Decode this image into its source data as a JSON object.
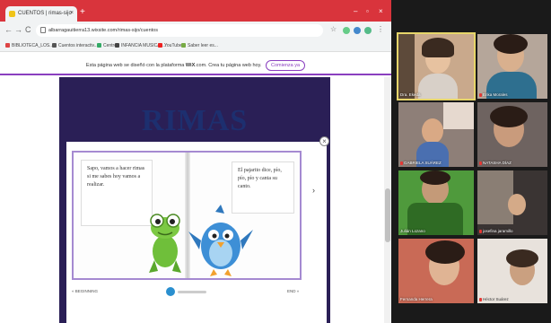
{
  "browser": {
    "tab_title": "CUENTOS | rimas-sijo",
    "tab_close": "×",
    "new_tab": "+",
    "window_controls": [
      "–",
      "▫",
      "×"
    ],
    "nav": {
      "back": "←",
      "forward": "→",
      "reload": "C"
    },
    "url": "albarragauitierra13.wixsite.com/rimas-sijo/cuentos",
    "bookmarks": [
      {
        "label": "BIBLIOTECA_LOS...",
        "color": "#d44"
      },
      {
        "label": "Cuentos interactiv...",
        "color": "#555"
      },
      {
        "label": "Centro",
        "color": "#3a6"
      },
      {
        "label": "INFANCIA MUSICAL...",
        "color": "#444"
      },
      {
        "label": "YouTube",
        "color": "#e22"
      },
      {
        "label": "Saber leer es...",
        "color": "#7a4"
      }
    ],
    "wix_banner": {
      "text": "Esta página web se diseñó con la plataforma",
      "brand": "WiX",
      "text2": ".com. Crea tu página web hoy.",
      "button": "Comienza ya"
    }
  },
  "site": {
    "title": "RIMAS",
    "book": {
      "left_text": "Sapo, vamos a hacer rimas si me sabes hoy vamos a realizar.",
      "right_text": "El pajarito dice, pío, pío, pío y canta su canto.",
      "next_arrow": "›",
      "beginning": "« BEGINNING",
      "end": "END »"
    },
    "close": "×"
  },
  "participants": [
    {
      "name": "Dra. Ekeda"
    },
    {
      "name": "Erika Morales"
    },
    {
      "name": "GABRIELA SUÁREZ"
    },
    {
      "name": "NATASHA DÍAZ"
    },
    {
      "name": "Julián Lozano"
    },
    {
      "name": "josefina jaramillo"
    },
    {
      "name": "Fernanda Herrera"
    },
    {
      "name": "Héctor Suárez"
    }
  ],
  "colors": {
    "chrome_red": "#d9343c",
    "wix_purple": "#8a3fbf",
    "active_speaker": "#e6d56a"
  }
}
